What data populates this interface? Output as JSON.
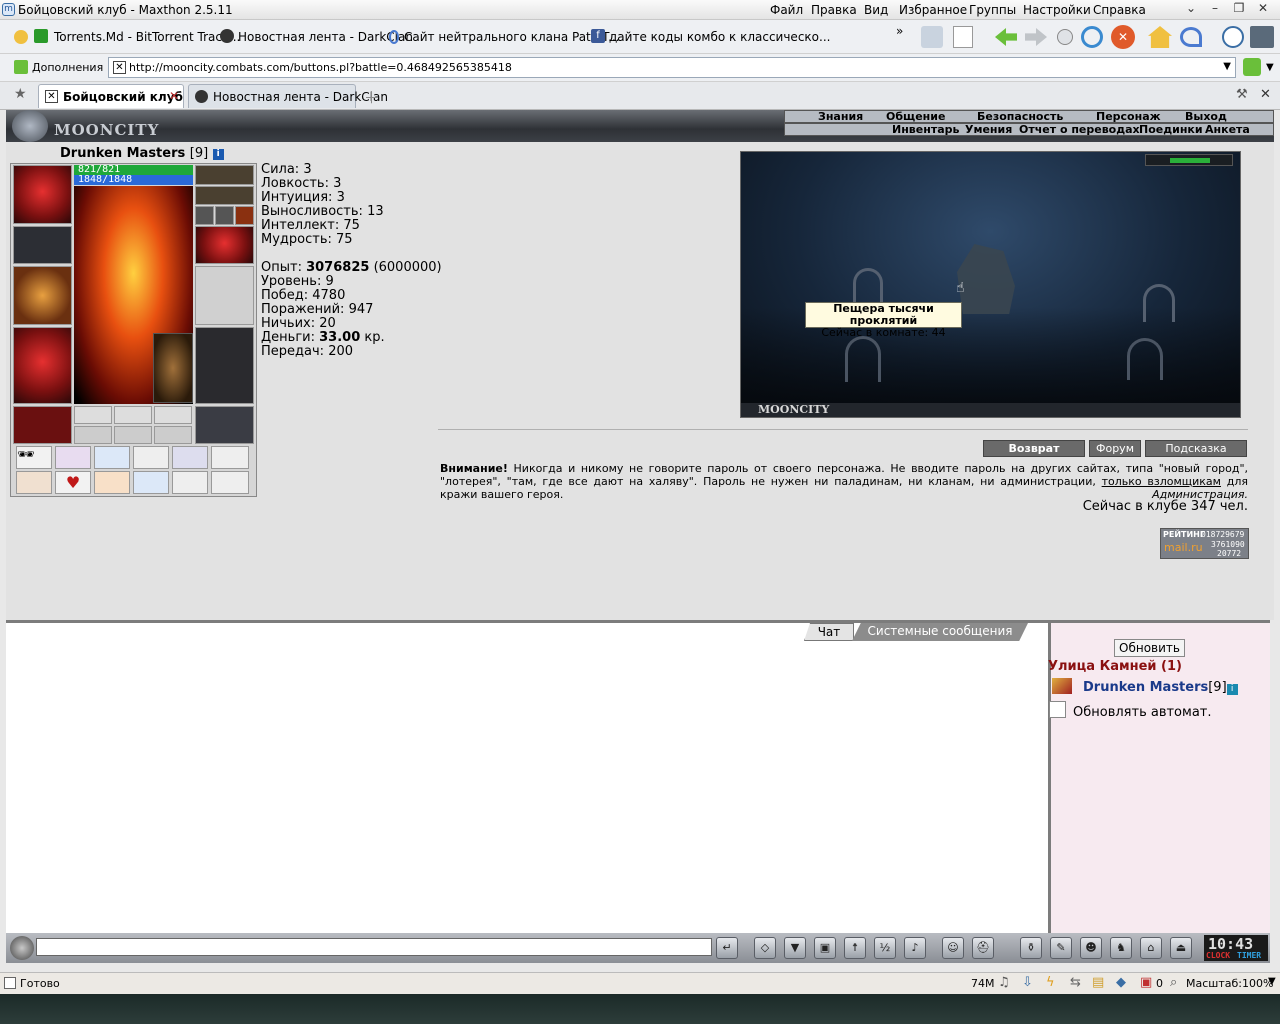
{
  "window": {
    "title": "Бойцовский клуб - Maxthon 2.5.11"
  },
  "menu": [
    "Файл",
    "Правка",
    "Вид",
    "Избранное",
    "Группы",
    "Настройки",
    "Справка"
  ],
  "bookmarks": [
    {
      "label": "Torrents.Md - BitTorrent Track...",
      "icon": "torrent-icon",
      "color": "#2a9a2a"
    },
    {
      "label": "Новостная лента - DarkClan",
      "icon": "skull-icon",
      "color": "#333333"
    },
    {
      "label": "Сайт нейтрального клана Path T...",
      "icon": "diamond-icon",
      "color": "#4a7ad0"
    },
    {
      "label": "дайте коды комбо к классическо...",
      "icon": "facebook-icon",
      "color": "#3b5998"
    }
  ],
  "addons_label": "Дополнения",
  "address": {
    "url": "http://mooncity.combats.com/buttons.pl?battle=0.468492565385418"
  },
  "tabs": [
    {
      "label": "Бойцовский клуб",
      "active": true
    },
    {
      "label": "Новостная лента - DarkClan",
      "active": false
    }
  ],
  "game": {
    "logo": "MOONCITY",
    "nav_top": [
      "Знания",
      "Общение",
      "Безопасность",
      "Персонаж",
      "Выход"
    ],
    "nav_bottom": [
      "Инвентарь",
      "Умения",
      "Отчет о переводах",
      "Поединки",
      "Анкета"
    ],
    "character": {
      "name": "Drunken Masters",
      "level_tag": "[9]",
      "hp": "821/821",
      "mana": "1848/1848",
      "hp_fill": 1.0,
      "mana_fill": 1.0
    },
    "stats": [
      {
        "label": "Сила:",
        "value": "3"
      },
      {
        "label": "Ловкость:",
        "value": "3"
      },
      {
        "label": "Интуиция:",
        "value": "3"
      },
      {
        "label": "Выносливость:",
        "value": "13"
      },
      {
        "label": "Интеллект:",
        "value": "75"
      },
      {
        "label": "Мудрость:",
        "value": "75"
      }
    ],
    "progress": {
      "exp_label": "Опыт:",
      "exp_value": "3076825",
      "exp_next": "(6000000)",
      "level_label": "Уровень:",
      "level_value": "9",
      "wins_label": "Побед:",
      "wins_value": "4780",
      "losses_label": "Поражений:",
      "losses_value": "947",
      "draws_label": "Ничьих:",
      "draws_value": "20",
      "money_label": "Деньги:",
      "money_value": "33.00",
      "money_unit": "кр.",
      "transfers_label": "Передач:",
      "transfers_value": "200"
    },
    "scene": {
      "caption": "MOONCITY",
      "tooltip_title": "Пещера тысячи проклятий",
      "tooltip_sub": "Сейчас в комнате: 44"
    },
    "buttons": {
      "back": "Возврат",
      "forum": "Форум",
      "hint": "Подсказка"
    },
    "warning": {
      "bold": "Внимание!",
      "text": "Никогда и никому не говорите пароль от своего персонажа. Не вводите пароль на других сайтах, типа \"новый город\", \"лотерея\", \"там, где все дают на халяву\". Пароль не нужен ни паладинам, ни кланам, ни администрации,",
      "link": "только взломщикам",
      "tail": "для кражи вашего героя.",
      "signature": "Администрация."
    },
    "online": "Сейчас в клубе 347 чел.",
    "counter": {
      "title": "РЕЙТИНГ",
      "l1": "018729679",
      "brand": "mail.ru",
      "l2": "3761090",
      "l3": "20772"
    }
  },
  "chat": {
    "tabs": [
      "Чат",
      "Системные сообщения"
    ],
    "refresh_button": "Обновить",
    "location": "Улица Камней (1)",
    "player_name": "Drunken Masters",
    "player_level": "[9]",
    "auto_refresh": "Обновлять автомат."
  },
  "clock": {
    "time": "10:43",
    "label_a": "CLOCK",
    "label_b": "TIMER"
  },
  "status": {
    "text": "Готово",
    "memory": "74M",
    "popup_count": "0",
    "zoom": "Масштаб:100%"
  }
}
